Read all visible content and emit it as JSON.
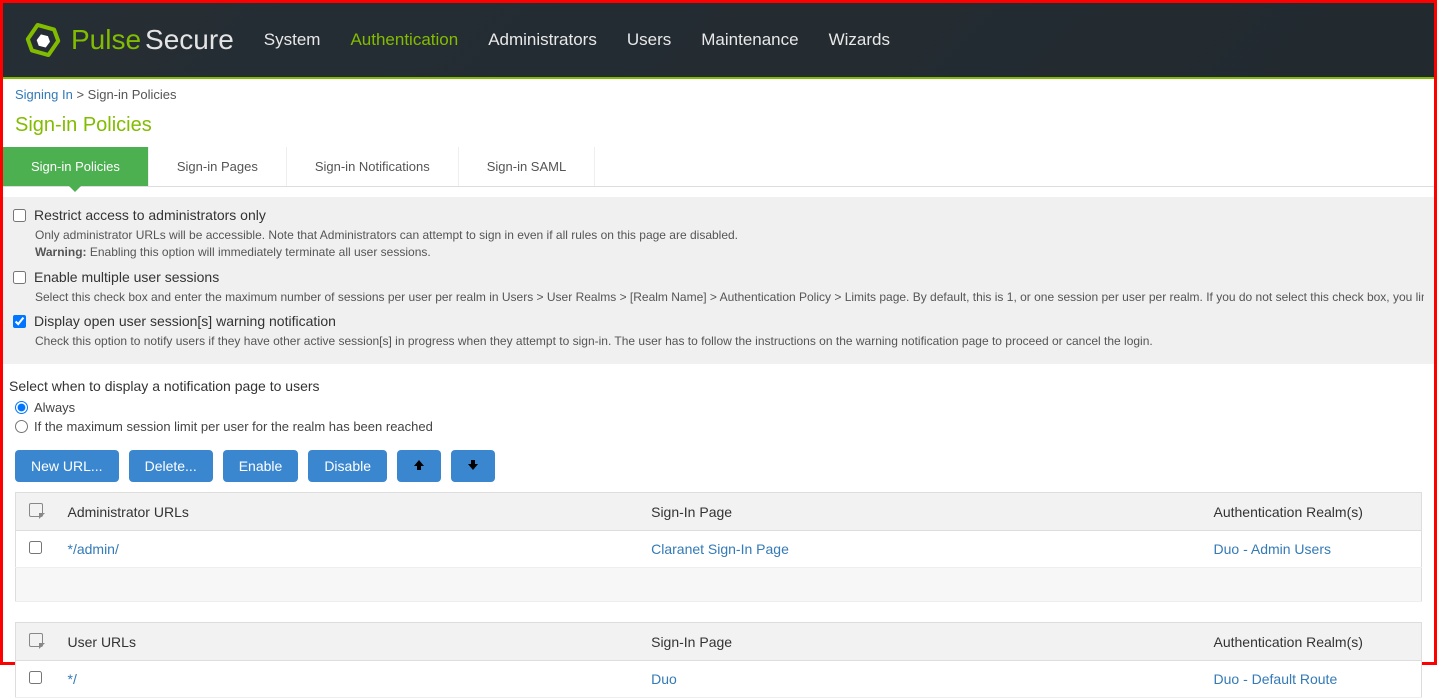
{
  "brand": {
    "pulse": "Pulse",
    "secure": "Secure"
  },
  "nav": {
    "items": [
      {
        "label": "System",
        "active": false
      },
      {
        "label": "Authentication",
        "active": true
      },
      {
        "label": "Administrators",
        "active": false
      },
      {
        "label": "Users",
        "active": false
      },
      {
        "label": "Maintenance",
        "active": false
      },
      {
        "label": "Wizards",
        "active": false
      }
    ]
  },
  "breadcrumb": {
    "parent": "Signing In",
    "sep": " > ",
    "current": "Sign-in Policies"
  },
  "page_title": "Sign-in Policies",
  "tabs": [
    {
      "label": "Sign-in Policies",
      "active": true
    },
    {
      "label": "Sign-in Pages",
      "active": false
    },
    {
      "label": "Sign-in Notifications",
      "active": false
    },
    {
      "label": "Sign-in SAML",
      "active": false
    }
  ],
  "options": {
    "restrict": {
      "checked": false,
      "label": "Restrict access to administrators only",
      "help": "Only administrator URLs will be accessible. Note that Administrators can attempt to sign in even if all rules on this page are disabled.",
      "warning_label": "Warning:",
      "warning": " Enabling this option will immediately terminate all user sessions."
    },
    "multi": {
      "checked": false,
      "label": "Enable multiple user sessions",
      "help": "Select this check box and enter the maximum number of sessions per user per realm in Users > User Realms > [Realm Name] > Authentication Policy > Limits page. By default, this is 1, or one session per user per realm. If you do not select this check box, you limit the user to one s"
    },
    "display_open": {
      "checked": true,
      "label": "Display open user session[s] warning notification",
      "help": "Check this option to notify users if they have other active session[s] in progress when they attempt to sign-in. The user has to follow the instructions on the warning notification page to proceed or cancel the login."
    }
  },
  "notify": {
    "title": "Select when to display a notification page to users",
    "always": {
      "label": "Always",
      "checked": true
    },
    "max": {
      "label": "If the maximum session limit per user for the realm has been reached",
      "checked": false
    }
  },
  "buttons": {
    "new_url": "New URL...",
    "delete": "Delete...",
    "enable": "Enable",
    "disable": "Disable"
  },
  "admin_table": {
    "headers": {
      "urls": "Administrator URLs",
      "page": "Sign-In Page",
      "realms": "Authentication Realm(s)"
    },
    "rows": [
      {
        "url": "*/admin/",
        "page": "Claranet Sign-In Page",
        "realm": "Duo - Admin Users"
      }
    ]
  },
  "user_table": {
    "headers": {
      "urls": "User URLs",
      "page": "Sign-In Page",
      "realms": "Authentication Realm(s)"
    },
    "rows": [
      {
        "url": "*/",
        "page": "Duo",
        "realm": "Duo - Default Route"
      }
    ]
  }
}
